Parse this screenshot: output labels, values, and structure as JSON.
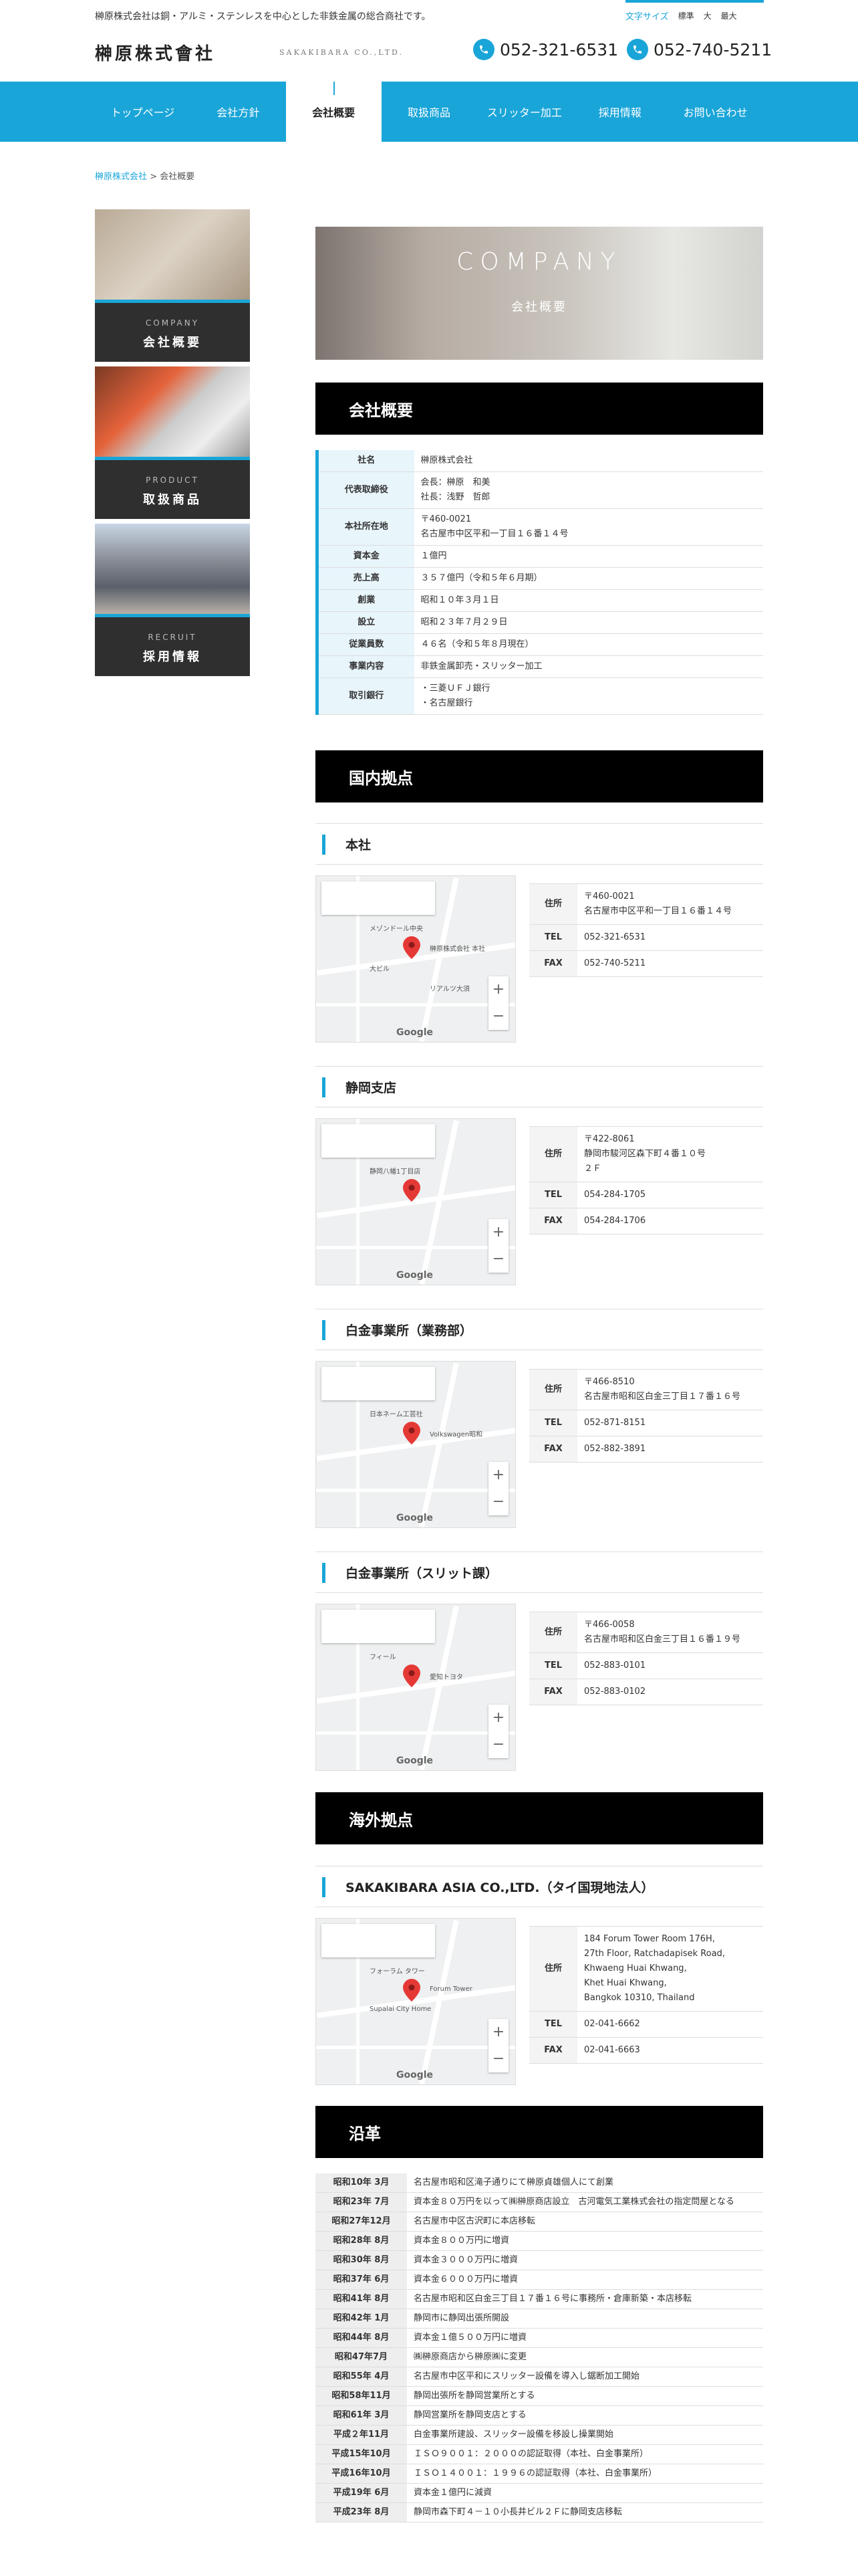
{
  "header": {
    "tagline": "榊原株式会社は銅・アルミ・ステンレスを中心とした非鉄金属の総合商社です。",
    "font_size_label": "文字サイズ",
    "font_size_options": [
      "標準",
      "大",
      "最大"
    ],
    "logo": "榊原株式會社",
    "logo_en": "SAKAKIBARA CO.,LTD.",
    "tel1": "052-321-6531",
    "tel2": "052-740-5211"
  },
  "nav": {
    "items": [
      "トップページ",
      "会社方針",
      "会社概要",
      "取扱商品",
      "スリッター加工",
      "採用情報",
      "お問い合わせ"
    ]
  },
  "breadcrumb": {
    "home": "榊原株式会社",
    "sep": " > ",
    "current": "会社概要"
  },
  "sidebar": [
    {
      "en": "COMPANY",
      "ja": "会社概要"
    },
    {
      "en": "PRODUCT",
      "ja": "取扱商品"
    },
    {
      "en": "RECRUIT",
      "ja": "採用情報"
    }
  ],
  "hero": {
    "en": "COMPANY",
    "ja": "会社概要"
  },
  "overview": {
    "title": "会社概要",
    "rows": [
      {
        "k": "社名",
        "v": [
          "榊原株式会社"
        ]
      },
      {
        "k": "代表取締役",
        "v": [
          "会長：榊原　和美",
          "社長：浅野　哲郎"
        ]
      },
      {
        "k": "本社所在地",
        "v": [
          "〒460-0021",
          "名古屋市中区平和一丁目１６番１４号"
        ]
      },
      {
        "k": "資本金",
        "v": [
          "１億円"
        ]
      },
      {
        "k": "売上高",
        "v": [
          "３５７億円（令和５年６月期）"
        ]
      },
      {
        "k": "創業",
        "v": [
          "昭和１０年３月１日"
        ]
      },
      {
        "k": "設立",
        "v": [
          "昭和２３年７月２９日"
        ]
      },
      {
        "k": "従業員数",
        "v": [
          "４６名（令和５年８月現在）"
        ]
      },
      {
        "k": "事業内容",
        "v": [
          "非鉄金属卸売・スリッター加工"
        ]
      },
      {
        "k": "取引銀行",
        "v": [
          "・三菱ＵＦＪ銀行",
          "・名古屋銀行"
        ]
      }
    ]
  },
  "domestic": {
    "title": "国内拠点",
    "locations": [
      {
        "name": "本社",
        "addr_label": "住所",
        "addr": [
          "〒460-0021",
          "名古屋市中区平和一丁目１６番１４号"
        ],
        "tel_label": "TEL",
        "tel": "052-321-6531",
        "fax_label": "FAX",
        "fax": "052-740-5211",
        "map_labels": [
          "メゾンドール中央",
          "榊原株式会社 本社",
          "大ビル",
          "リアルツ大須"
        ]
      },
      {
        "name": "静岡支店",
        "addr_label": "住所",
        "addr": [
          "〒422-8061",
          "静岡市駿河区森下町４番１０号",
          "２Ｆ"
        ],
        "tel_label": "TEL",
        "tel": "054-284-1705",
        "fax_label": "FAX",
        "fax": "054-284-1706",
        "map_labels": [
          "静岡八幡1丁目店"
        ]
      },
      {
        "name": "白金事業所（業務部）",
        "addr_label": "住所",
        "addr": [
          "〒466-8510",
          "名古屋市昭和区白金三丁目１７番１６号"
        ],
        "tel_label": "TEL",
        "tel": "052-871-8151",
        "fax_label": "FAX",
        "fax": "052-882-3891",
        "map_labels": [
          "日本ネーム工芸社",
          "Volkswagen昭和"
        ]
      },
      {
        "name": "白金事業所（スリット課）",
        "addr_label": "住所",
        "addr": [
          "〒466-0058",
          "名古屋市昭和区白金三丁目１６番１９号"
        ],
        "tel_label": "TEL",
        "tel": "052-883-0101",
        "fax_label": "FAX",
        "fax": "052-883-0102",
        "map_labels": [
          "フィール",
          "愛知トヨタ"
        ]
      }
    ]
  },
  "overseas": {
    "title": "海外拠点",
    "locations": [
      {
        "name": "SAKAKIBARA ASIA CO.,LTD.（タイ国現地法人）",
        "addr_label": "住所",
        "addr": [
          "184 Forum Tower Room 176H,",
          "27th Floor, Ratchadapisek Road,",
          "Khwaeng Huai Khwang,",
          "Khet Huai Khwang,",
          "Bangkok 10310, Thailand"
        ],
        "tel_label": "TEL",
        "tel": "02-041-6662",
        "fax_label": "FAX",
        "fax": "02-041-6663",
        "map_labels": [
          "フォーラム タワー",
          "Forum Tower",
          "Supalai City Home"
        ]
      }
    ]
  },
  "history": {
    "title": "沿革",
    "rows": [
      {
        "k": "昭和10年 3月",
        "v": "名古屋市昭和区滝子通りにて榊原貞雄個人にて創業"
      },
      {
        "k": "昭和23年 7月",
        "v": "資本金８０万円を以って㈱榊原商店設立　古河電気工業株式会社の指定問屋となる"
      },
      {
        "k": "昭和27年12月",
        "v": "名古屋市中区古沢町に本店移転"
      },
      {
        "k": "昭和28年 8月",
        "v": "資本金８００万円に増資"
      },
      {
        "k": "昭和30年 8月",
        "v": "資本金３０００万円に増資"
      },
      {
        "k": "昭和37年 6月",
        "v": "資本金６０００万円に増資"
      },
      {
        "k": "昭和41年 8月",
        "v": "名古屋市昭和区白金三丁目１７番１６号に事務所・倉庫新築・本店移転"
      },
      {
        "k": "昭和42年 1月",
        "v": "静岡市に静岡出張所開設"
      },
      {
        "k": "昭和44年 8月",
        "v": "資本金１億５００万円に増資"
      },
      {
        "k": "昭和47年7月",
        "v": "㈱榊原商店から榊原㈱に変更"
      },
      {
        "k": "昭和55年 4月",
        "v": "名古屋市中区平和にスリッター設備を導入し鋸断加工開始"
      },
      {
        "k": "昭和58年11月",
        "v": "静岡出張所を静岡営業所とする"
      },
      {
        "k": "昭和61年 3月",
        "v": "静岡営業所を静岡支店とする"
      },
      {
        "k": "平成２年11月",
        "v": "白金事業所建設、スリッター設備を移設し操業開始"
      },
      {
        "k": "平成15年10月",
        "v": "ＩＳＯ９００１：２０００の認証取得（本社、白金事業所）"
      },
      {
        "k": "平成16年10月",
        "v": "ＩＳＯ１４００１：１９９６の認証取得（本社、白金事業所）"
      },
      {
        "k": "平成19年 6月",
        "v": "資本金１億円に減資"
      },
      {
        "k": "平成23年 8月",
        "v": "静岡市森下町４－１０小長井ビル２Ｆに静岡支店移転"
      }
    ]
  }
}
